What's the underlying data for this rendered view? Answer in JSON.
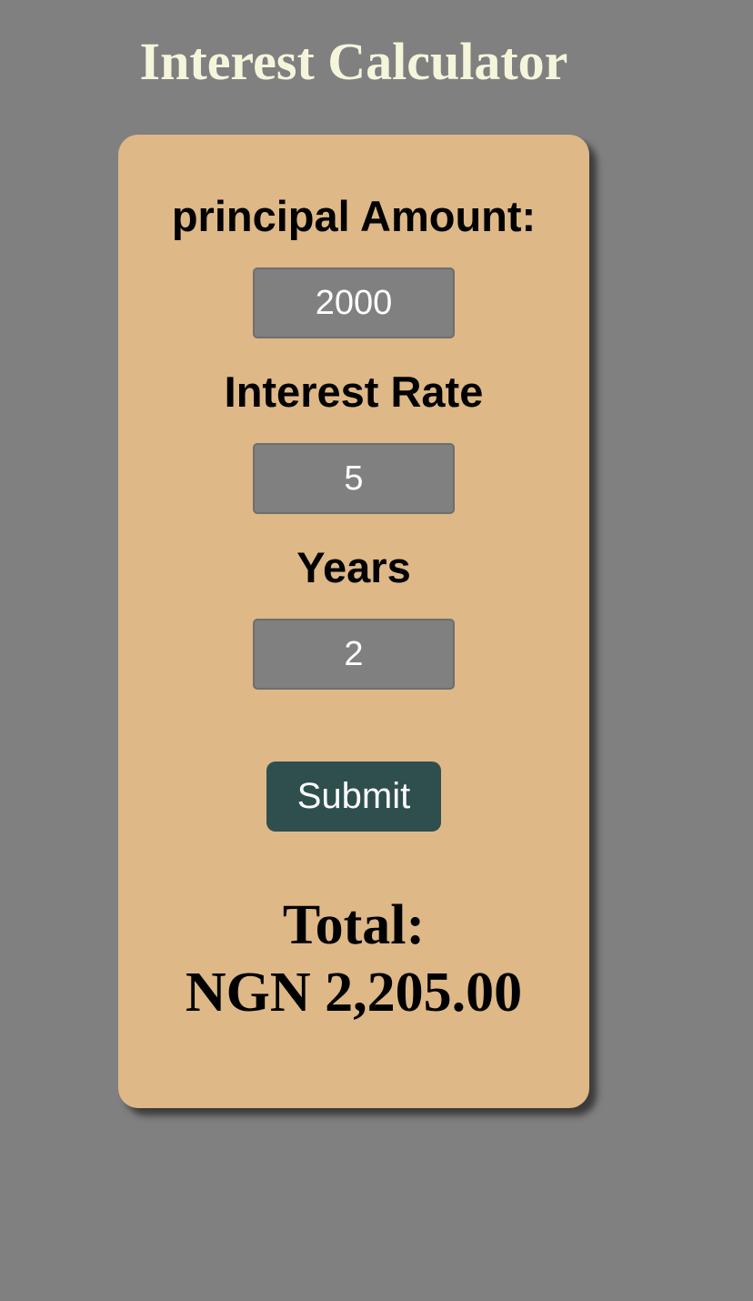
{
  "app": {
    "title": "Interest Calculator"
  },
  "form": {
    "principal": {
      "label": "principal Amount:",
      "value": "2000"
    },
    "rate": {
      "label": "Interest Rate",
      "value": "5"
    },
    "years": {
      "label": "Years",
      "value": "2"
    },
    "submit_label": "Submit"
  },
  "result": {
    "label": "Total:",
    "value": "NGN 2,205.00"
  },
  "colors": {
    "background": "#808080",
    "card": "#deb887",
    "title": "#f5f5dc",
    "input": "#808080",
    "button": "#2f4f4f"
  }
}
